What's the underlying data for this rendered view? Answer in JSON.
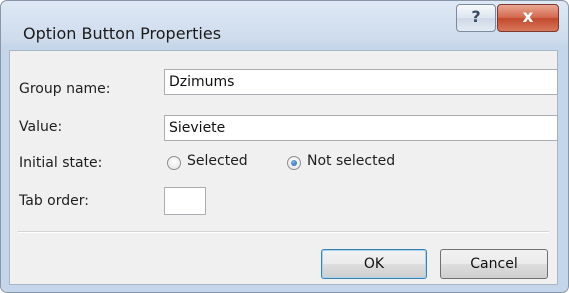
{
  "window": {
    "title": "Option Button Properties"
  },
  "titlebar": {
    "help_glyph": "?",
    "close_glyph": "x"
  },
  "form": {
    "group_name_label": "Group name:",
    "group_name_value": "Dzimums",
    "value_label": "Value:",
    "value_value": "Sieviete",
    "initial_state_label": "Initial state:",
    "selected_label": "Selected",
    "not_selected_label": "Not selected",
    "initial_state_selected": "Not selected",
    "tab_order_label": "Tab order:",
    "tab_order_value": ""
  },
  "buttons": {
    "ok_label": "OK",
    "cancel_label": "Cancel"
  },
  "colors": {
    "default_button_border": "#3c7fb1",
    "close_button": "#c24a2f",
    "window_frame": "#c6d6ea"
  }
}
